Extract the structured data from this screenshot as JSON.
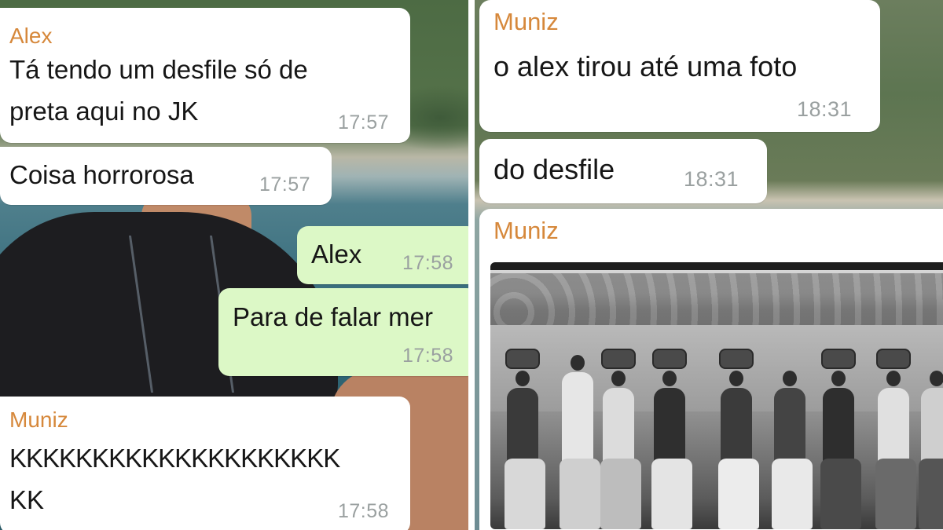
{
  "left": {
    "messages": [
      {
        "sender": "Alex",
        "line1": "Tá tendo um desfile só de",
        "line2": "preta aqui no JK",
        "time": "17:57"
      },
      {
        "text": "Coisa horrorosa",
        "time": "17:57"
      },
      {
        "text": "Alex",
        "time": "17:58"
      },
      {
        "text": "Para de falar mer",
        "time": "17:58"
      },
      {
        "sender": "Muniz",
        "line1": "KKKKKKKKKKKKKKKKKKKK",
        "line2": "KK",
        "time": "17:58"
      }
    ]
  },
  "right": {
    "messages": [
      {
        "sender": "Muniz",
        "text": "o alex tirou até uma foto",
        "time": "18:31"
      },
      {
        "text": "do desfile",
        "time": "18:31"
      },
      {
        "sender": "Muniz"
      }
    ]
  },
  "colors": {
    "incoming_bubble": "#ffffff",
    "outgoing_bubble": "#dcf8c6",
    "sender_name": "#d6883b",
    "timestamp": "#9aa0a0"
  }
}
